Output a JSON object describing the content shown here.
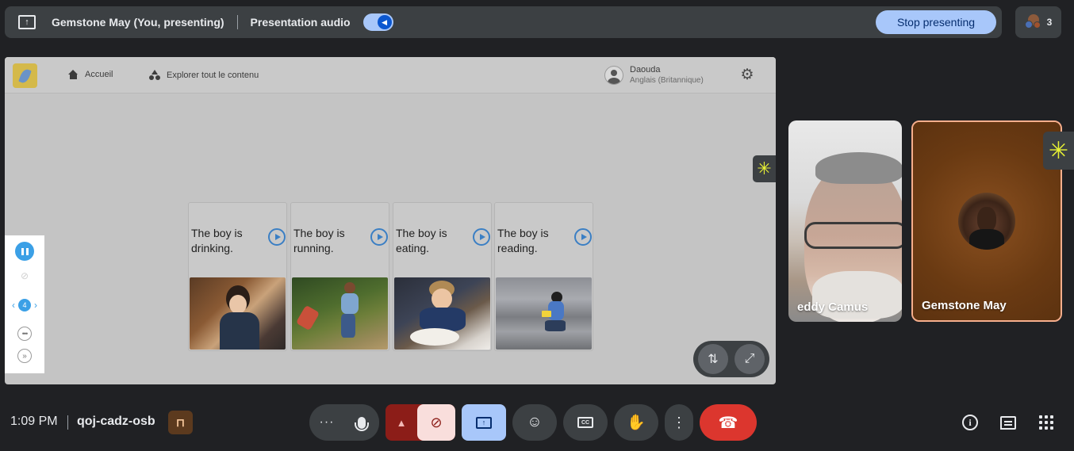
{
  "top_bar": {
    "presenter_title": "Gemstone May (You, presenting)",
    "audio_label": "Presentation audio",
    "audio_on": true,
    "stop_label": "Stop presenting",
    "participant_count": "3"
  },
  "shared_screen": {
    "nav": {
      "home_label": "Accueil",
      "explore_label": "Explorer tout le contenu"
    },
    "user": {
      "name": "Daouda",
      "language": "Anglais (Britannique)"
    },
    "side_panel": {
      "page": "4",
      "prev_glyph": "‹",
      "next_glyph": "›"
    },
    "cards": [
      {
        "text": "The boy is drinking."
      },
      {
        "text": "The boy is running."
      },
      {
        "text": "The boy is eating."
      },
      {
        "text": "The boy is reading."
      }
    ]
  },
  "participants": [
    {
      "name": "eddy Camus"
    },
    {
      "name": "Gemstone May",
      "active_speaker": true
    }
  ],
  "bottom_bar": {
    "time": "1:09 PM",
    "meeting_code": "qoj-cadz-osb"
  },
  "colors": {
    "background": "#202124",
    "bar_surface": "#3c4043",
    "accent_blue": "#a8c7fa",
    "end_call_red": "#dc362e",
    "camera_off_bg": "#f9dedc",
    "active_border": "#f6ae8c"
  },
  "icons": [
    "present-screen-icon",
    "speaker-icon",
    "home-icon",
    "shapes-icon",
    "user-avatar-icon",
    "gear-icon",
    "pause-icon",
    "eye-off-icon",
    "chevron-left-icon",
    "chevron-right-icon",
    "more-horizontal-icon",
    "skip-forward-icon",
    "play-icon",
    "swap-icon",
    "fullscreen-icon",
    "gemini-sparkle-icon",
    "door-icon",
    "more-options-icon",
    "mic-icon",
    "chevron-up-icon",
    "camera-off-icon",
    "present-icon",
    "emoji-icon",
    "captions-icon",
    "raise-hand-icon",
    "more-vert-icon",
    "end-call-icon",
    "info-icon",
    "chat-icon",
    "apps-icon"
  ]
}
